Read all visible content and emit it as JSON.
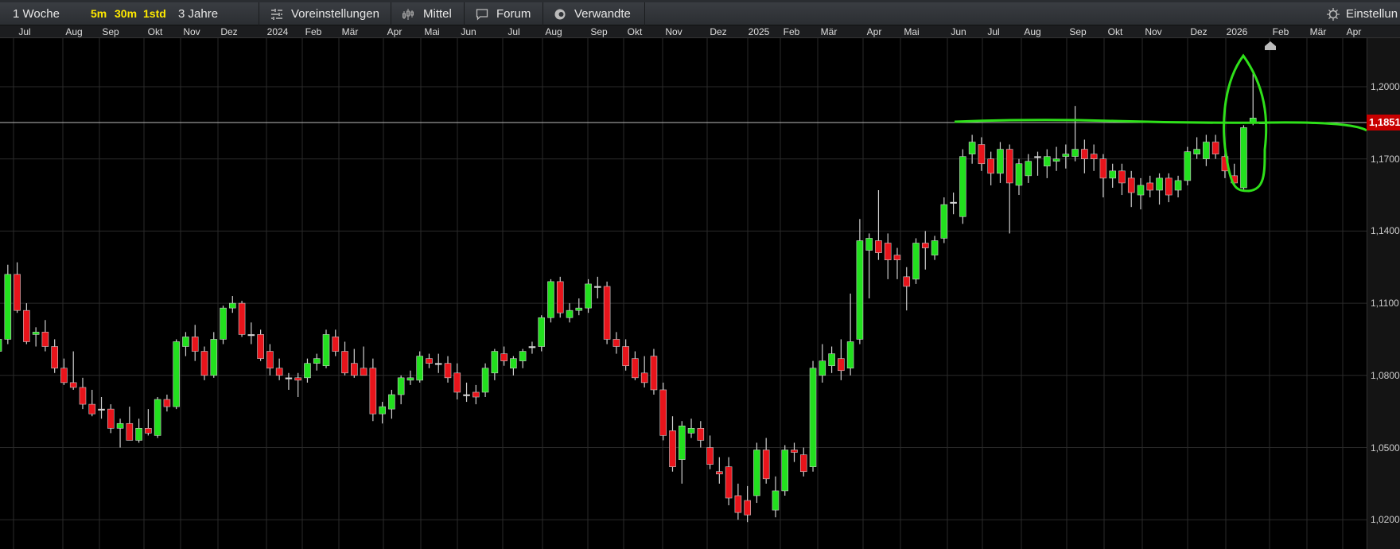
{
  "toolbar": {
    "period": "1 Woche",
    "intervals": [
      "5m",
      "30m",
      "1std"
    ],
    "range": "3 Jahre",
    "presets": "Voreinstellungen",
    "indicators": "Mittel",
    "forum": "Forum",
    "related": "Verwandte",
    "settings": "Einstellun"
  },
  "chart_data": {
    "type": "candlestick",
    "interval": "weekly",
    "x_tick_labels": [
      "Jul",
      "Aug",
      "Sep",
      "Okt",
      "Nov",
      "Dez",
      "2024",
      "Feb",
      "Mär",
      "Apr",
      "Mai",
      "Jun",
      "Jul",
      "Aug",
      "Sep",
      "Okt",
      "Nov",
      "Dez",
      "2025",
      "Feb",
      "Mär",
      "Apr",
      "Mai",
      "Jun",
      "Jul",
      "Aug",
      "Sep",
      "Okt",
      "Nov",
      "Dez",
      "2026",
      "Feb",
      "Mär",
      "Apr"
    ],
    "y_tick_labels": [
      "1,2000",
      "1,1700",
      "1,1400",
      "1,1100",
      "1,0800",
      "1,0500",
      "1,0200"
    ],
    "y_ticks": [
      1.2,
      1.17,
      1.14,
      1.11,
      1.08,
      1.05,
      1.02
    ],
    "ylim": [
      1.006,
      1.243
    ],
    "last_price": "1,1851",
    "last_price_value": 1.1851,
    "grid": true,
    "colors": {
      "up": "#22e01e",
      "down": "#e8141b",
      "wick": "#cfcfcf",
      "annotation": "#2fe01a",
      "last_price_bg": "#c80000"
    },
    "ohlc": [
      [
        1.091,
        1.095,
        1.087,
        1.091
      ],
      [
        1.09,
        1.098,
        1.086,
        1.095
      ],
      [
        1.095,
        1.126,
        1.093,
        1.122
      ],
      [
        1.122,
        1.127,
        1.106,
        1.107
      ],
      [
        1.107,
        1.11,
        1.093,
        1.094
      ],
      [
        1.097,
        1.1,
        1.092,
        1.098
      ],
      [
        1.098,
        1.103,
        1.09,
        1.092
      ],
      [
        1.092,
        1.095,
        1.081,
        1.083
      ],
      [
        1.083,
        1.087,
        1.076,
        1.077
      ],
      [
        1.077,
        1.09,
        1.074,
        1.075
      ],
      [
        1.075,
        1.079,
        1.066,
        1.068
      ],
      [
        1.068,
        1.074,
        1.063,
        1.064
      ],
      [
        1.066,
        1.071,
        1.062,
        1.066
      ],
      [
        1.066,
        1.068,
        1.056,
        1.058
      ],
      [
        1.058,
        1.062,
        1.05,
        1.06
      ],
      [
        1.06,
        1.067,
        1.054,
        1.053
      ],
      [
        1.053,
        1.062,
        1.052,
        1.058
      ],
      [
        1.058,
        1.066,
        1.055,
        1.056
      ],
      [
        1.055,
        1.071,
        1.054,
        1.07
      ],
      [
        1.07,
        1.072,
        1.065,
        1.067
      ],
      [
        1.067,
        1.095,
        1.066,
        1.094
      ],
      [
        1.092,
        1.098,
        1.088,
        1.096
      ],
      [
        1.096,
        1.101,
        1.086,
        1.09
      ],
      [
        1.09,
        1.092,
        1.078,
        1.08
      ],
      [
        1.08,
        1.098,
        1.079,
        1.095
      ],
      [
        1.095,
        1.109,
        1.093,
        1.108
      ],
      [
        1.108,
        1.113,
        1.106,
        1.11
      ],
      [
        1.11,
        1.111,
        1.096,
        1.097
      ],
      [
        1.097,
        1.102,
        1.093,
        1.097
      ],
      [
        1.097,
        1.099,
        1.086,
        1.087
      ],
      [
        1.09,
        1.093,
        1.08,
        1.083
      ],
      [
        1.083,
        1.087,
        1.078,
        1.08
      ],
      [
        1.079,
        1.081,
        1.074,
        1.079
      ],
      [
        1.079,
        1.081,
        1.071,
        1.078
      ],
      [
        1.079,
        1.087,
        1.077,
        1.085
      ],
      [
        1.085,
        1.089,
        1.082,
        1.087
      ],
      [
        1.084,
        1.099,
        1.083,
        1.097
      ],
      [
        1.096,
        1.099,
        1.088,
        1.09
      ],
      [
        1.09,
        1.094,
        1.08,
        1.081
      ],
      [
        1.085,
        1.091,
        1.079,
        1.08
      ],
      [
        1.083,
        1.092,
        1.08,
        1.08
      ],
      [
        1.083,
        1.087,
        1.061,
        1.064
      ],
      [
        1.064,
        1.069,
        1.06,
        1.067
      ],
      [
        1.066,
        1.074,
        1.062,
        1.072
      ],
      [
        1.072,
        1.08,
        1.068,
        1.079
      ],
      [
        1.078,
        1.082,
        1.076,
        1.079
      ],
      [
        1.078,
        1.09,
        1.077,
        1.088
      ],
      [
        1.087,
        1.089,
        1.083,
        1.085
      ],
      [
        1.085,
        1.089,
        1.081,
        1.085
      ],
      [
        1.085,
        1.088,
        1.077,
        1.079
      ],
      [
        1.081,
        1.085,
        1.07,
        1.073
      ],
      [
        1.072,
        1.077,
        1.069,
        1.072
      ],
      [
        1.073,
        1.076,
        1.068,
        1.071
      ],
      [
        1.073,
        1.085,
        1.071,
        1.083
      ],
      [
        1.081,
        1.091,
        1.078,
        1.09
      ],
      [
        1.089,
        1.092,
        1.084,
        1.086
      ],
      [
        1.083,
        1.088,
        1.08,
        1.087
      ],
      [
        1.086,
        1.091,
        1.083,
        1.09
      ],
      [
        1.092,
        1.094,
        1.089,
        1.092
      ],
      [
        1.092,
        1.105,
        1.09,
        1.104
      ],
      [
        1.104,
        1.12,
        1.102,
        1.119
      ],
      [
        1.119,
        1.121,
        1.104,
        1.106
      ],
      [
        1.104,
        1.11,
        1.102,
        1.107
      ],
      [
        1.107,
        1.112,
        1.105,
        1.108
      ],
      [
        1.108,
        1.12,
        1.106,
        1.118
      ],
      [
        1.117,
        1.121,
        1.112,
        1.117
      ],
      [
        1.117,
        1.119,
        1.093,
        1.095
      ],
      [
        1.095,
        1.098,
        1.089,
        1.092
      ],
      [
        1.092,
        1.095,
        1.082,
        1.084
      ],
      [
        1.087,
        1.09,
        1.078,
        1.079
      ],
      [
        1.081,
        1.088,
        1.075,
        1.077
      ],
      [
        1.088,
        1.091,
        1.072,
        1.074
      ],
      [
        1.074,
        1.077,
        1.053,
        1.055
      ],
      [
        1.057,
        1.063,
        1.04,
        1.042
      ],
      [
        1.045,
        1.061,
        1.035,
        1.059
      ],
      [
        1.056,
        1.062,
        1.054,
        1.058
      ],
      [
        1.058,
        1.061,
        1.05,
        1.053
      ],
      [
        1.05,
        1.055,
        1.041,
        1.043
      ],
      [
        1.04,
        1.046,
        1.035,
        1.039
      ],
      [
        1.042,
        1.046,
        1.026,
        1.029
      ],
      [
        1.03,
        1.035,
        1.02,
        1.023
      ],
      [
        1.028,
        1.034,
        1.019,
        1.022
      ],
      [
        1.03,
        1.052,
        1.027,
        1.049
      ],
      [
        1.049,
        1.054,
        1.035,
        1.037
      ],
      [
        1.024,
        1.038,
        1.021,
        1.032
      ],
      [
        1.032,
        1.051,
        1.03,
        1.049
      ],
      [
        1.049,
        1.052,
        1.044,
        1.048
      ],
      [
        1.047,
        1.05,
        1.038,
        1.04
      ],
      [
        1.042,
        1.086,
        1.04,
        1.083
      ],
      [
        1.08,
        1.093,
        1.077,
        1.086
      ],
      [
        1.084,
        1.092,
        1.081,
        1.089
      ],
      [
        1.087,
        1.095,
        1.078,
        1.082
      ],
      [
        1.083,
        1.114,
        1.08,
        1.094
      ],
      [
        1.095,
        1.145,
        1.093,
        1.136
      ],
      [
        1.132,
        1.139,
        1.112,
        1.137
      ],
      [
        1.136,
        1.157,
        1.128,
        1.131
      ],
      [
        1.135,
        1.139,
        1.12,
        1.128
      ],
      [
        1.13,
        1.133,
        1.12,
        1.128
      ],
      [
        1.121,
        1.125,
        1.107,
        1.117
      ],
      [
        1.12,
        1.137,
        1.118,
        1.135
      ],
      [
        1.135,
        1.14,
        1.124,
        1.133
      ],
      [
        1.13,
        1.138,
        1.128,
        1.136
      ],
      [
        1.137,
        1.154,
        1.135,
        1.151
      ],
      [
        1.152,
        1.156,
        1.147,
        1.152
      ],
      [
        1.146,
        1.174,
        1.143,
        1.171
      ],
      [
        1.172,
        1.18,
        1.168,
        1.177
      ],
      [
        1.176,
        1.179,
        1.165,
        1.168
      ],
      [
        1.17,
        1.173,
        1.159,
        1.164
      ],
      [
        1.164,
        1.177,
        1.16,
        1.174
      ],
      [
        1.174,
        1.176,
        1.139,
        1.16
      ],
      [
        1.159,
        1.17,
        1.155,
        1.168
      ],
      [
        1.163,
        1.172,
        1.16,
        1.169
      ],
      [
        1.171,
        1.173,
        1.163,
        1.171
      ],
      [
        1.167,
        1.174,
        1.162,
        1.171
      ],
      [
        1.169,
        1.175,
        1.165,
        1.17
      ],
      [
        1.171,
        1.176,
        1.166,
        1.172
      ],
      [
        1.171,
        1.192,
        1.169,
        1.174
      ],
      [
        1.174,
        1.178,
        1.164,
        1.17
      ],
      [
        1.172,
        1.176,
        1.165,
        1.17
      ],
      [
        1.17,
        1.172,
        1.154,
        1.162
      ],
      [
        1.162,
        1.168,
        1.158,
        1.165
      ],
      [
        1.165,
        1.168,
        1.155,
        1.16
      ],
      [
        1.162,
        1.165,
        1.15,
        1.156
      ],
      [
        1.155,
        1.162,
        1.149,
        1.159
      ],
      [
        1.16,
        1.163,
        1.154,
        1.157
      ],
      [
        1.157,
        1.164,
        1.151,
        1.162
      ],
      [
        1.162,
        1.164,
        1.152,
        1.155
      ],
      [
        1.157,
        1.163,
        1.154,
        1.161
      ],
      [
        1.161,
        1.175,
        1.159,
        1.173
      ],
      [
        1.172,
        1.179,
        1.17,
        1.174
      ],
      [
        1.17,
        1.18,
        1.167,
        1.177
      ],
      [
        1.177,
        1.18,
        1.17,
        1.172
      ],
      [
        1.171,
        1.175,
        1.162,
        1.165
      ],
      [
        1.163,
        1.168,
        1.159,
        1.16
      ],
      [
        1.158,
        1.184,
        1.157,
        1.183
      ],
      [
        1.185,
        1.206,
        1.184,
        1.187
      ],
      [
        1.1851,
        1.1853,
        1.1849,
        1.1851
      ]
    ]
  }
}
